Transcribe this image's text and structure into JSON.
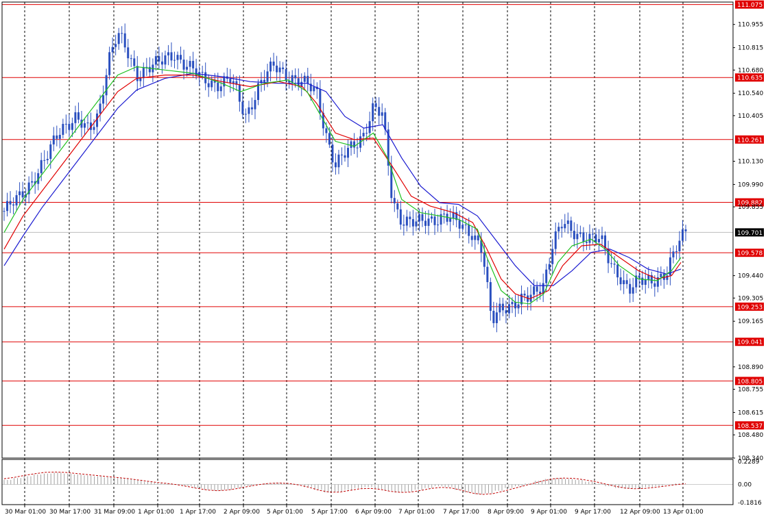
{
  "chart_data": {
    "type": "candlestick",
    "price_axis": {
      "min": 108.34,
      "max": 111.09,
      "tick_labels": [
        "110.955",
        "110.815",
        "110.680",
        "110.540",
        "110.405",
        "110.130",
        "109.990",
        "109.855",
        "109.440",
        "109.305",
        "109.165",
        "108.890",
        "108.755",
        "108.615",
        "108.480",
        "108.340"
      ]
    },
    "current_price": {
      "value": 109.701,
      "label": "109.701",
      "color": "#000000"
    },
    "levels": [
      {
        "value": 111.075,
        "label": "111.075"
      },
      {
        "value": 110.635,
        "label": "110.635"
      },
      {
        "value": 110.261,
        "label": "110.261"
      },
      {
        "value": 109.882,
        "label": "109.882"
      },
      {
        "value": 109.578,
        "label": "109.578"
      },
      {
        "value": 109.253,
        "label": "109.253"
      },
      {
        "value": 109.041,
        "label": "109.041"
      },
      {
        "value": 108.805,
        "label": "108.805"
      },
      {
        "value": 108.537,
        "label": "108.537"
      }
    ],
    "time_labels": [
      "30 Mar 01:00",
      "30 Mar 17:00",
      "31 Mar 09:00",
      "1 Apr 01:00",
      "1 Apr 17:00",
      "2 Apr 09:00",
      "5 Apr 01:00",
      "5 Apr 17:00",
      "6 Apr 09:00",
      "7 Apr 01:00",
      "7 Apr 17:00",
      "8 Apr 09:00",
      "9 Apr 01:00",
      "9 Apr 17:00",
      "12 Apr 09:00",
      "13 Apr 01:00"
    ],
    "close_path": [
      [
        0,
        109.83
      ],
      [
        3,
        109.9
      ],
      [
        6,
        110.02
      ],
      [
        9,
        110.15
      ],
      [
        12,
        110.33
      ],
      [
        15,
        110.4
      ],
      [
        18,
        110.3
      ],
      [
        20,
        110.42
      ],
      [
        22,
        110.75
      ],
      [
        24,
        110.9
      ],
      [
        26,
        110.78
      ],
      [
        28,
        110.65
      ],
      [
        30,
        110.7
      ],
      [
        33,
        110.72
      ],
      [
        36,
        110.78
      ],
      [
        39,
        110.7
      ],
      [
        42,
        110.62
      ],
      [
        45,
        110.6
      ],
      [
        48,
        110.62
      ],
      [
        51,
        110.4
      ],
      [
        54,
        110.6
      ],
      [
        57,
        110.7
      ],
      [
        60,
        110.65
      ],
      [
        63,
        110.6
      ],
      [
        66,
        110.55
      ],
      [
        68,
        110.3
      ],
      [
        70,
        110.1
      ],
      [
        73,
        110.2
      ],
      [
        76,
        110.3
      ],
      [
        78,
        110.45
      ],
      [
        80,
        110.4
      ],
      [
        82,
        109.9
      ],
      [
        84,
        109.78
      ],
      [
        87,
        109.75
      ],
      [
        90,
        109.78
      ],
      [
        93,
        109.8
      ],
      [
        96,
        109.75
      ],
      [
        99,
        109.7
      ],
      [
        101,
        109.6
      ],
      [
        103,
        109.15
      ],
      [
        105,
        109.25
      ],
      [
        108,
        109.28
      ],
      [
        111,
        109.3
      ],
      [
        114,
        109.4
      ],
      [
        116,
        109.65
      ],
      [
        118,
        109.75
      ],
      [
        120,
        109.7
      ],
      [
        123,
        109.68
      ],
      [
        126,
        109.65
      ],
      [
        128,
        109.52
      ],
      [
        130,
        109.45
      ],
      [
        132,
        109.35
      ],
      [
        134,
        109.4
      ],
      [
        137,
        109.42
      ],
      [
        140,
        109.45
      ],
      [
        142,
        109.6
      ],
      [
        144,
        109.72
      ]
    ],
    "ma_fast": [
      [
        0,
        109.7
      ],
      [
        4,
        109.9
      ],
      [
        8,
        110.05
      ],
      [
        12,
        110.2
      ],
      [
        16,
        110.35
      ],
      [
        20,
        110.5
      ],
      [
        24,
        110.65
      ],
      [
        28,
        110.7
      ],
      [
        34,
        110.68
      ],
      [
        40,
        110.66
      ],
      [
        46,
        110.6
      ],
      [
        50,
        110.55
      ],
      [
        55,
        110.6
      ],
      [
        60,
        110.62
      ],
      [
        64,
        110.55
      ],
      [
        67,
        110.4
      ],
      [
        70,
        110.25
      ],
      [
        74,
        110.22
      ],
      [
        78,
        110.3
      ],
      [
        81,
        110.15
      ],
      [
        84,
        109.9
      ],
      [
        88,
        109.82
      ],
      [
        92,
        109.8
      ],
      [
        96,
        109.78
      ],
      [
        100,
        109.72
      ],
      [
        102,
        109.55
      ],
      [
        105,
        109.35
      ],
      [
        108,
        109.28
      ],
      [
        111,
        109.27
      ],
      [
        114,
        109.33
      ],
      [
        117,
        109.52
      ],
      [
        120,
        109.62
      ],
      [
        124,
        109.66
      ],
      [
        127,
        109.6
      ],
      [
        130,
        109.5
      ],
      [
        134,
        109.42
      ],
      [
        138,
        109.41
      ],
      [
        141,
        109.47
      ],
      [
        143,
        109.55
      ]
    ],
    "ma_mid": [
      [
        0,
        109.6
      ],
      [
        4,
        109.8
      ],
      [
        8,
        109.95
      ],
      [
        12,
        110.1
      ],
      [
        16,
        110.25
      ],
      [
        20,
        110.4
      ],
      [
        24,
        110.55
      ],
      [
        28,
        110.63
      ],
      [
        34,
        110.65
      ],
      [
        40,
        110.65
      ],
      [
        46,
        110.61
      ],
      [
        52,
        110.58
      ],
      [
        58,
        110.61
      ],
      [
        63,
        110.58
      ],
      [
        66,
        110.48
      ],
      [
        70,
        110.3
      ],
      [
        74,
        110.26
      ],
      [
        78,
        110.27
      ],
      [
        82,
        110.1
      ],
      [
        86,
        109.92
      ],
      [
        90,
        109.86
      ],
      [
        95,
        109.82
      ],
      [
        99,
        109.76
      ],
      [
        102,
        109.6
      ],
      [
        105,
        109.42
      ],
      [
        108,
        109.33
      ],
      [
        111,
        109.3
      ],
      [
        115,
        109.35
      ],
      [
        118,
        109.5
      ],
      [
        122,
        109.62
      ],
      [
        126,
        109.63
      ],
      [
        130,
        109.55
      ],
      [
        134,
        109.47
      ],
      [
        138,
        109.42
      ],
      [
        141,
        109.44
      ],
      [
        143,
        109.52
      ]
    ],
    "ma_slow": [
      [
        0,
        109.5
      ],
      [
        4,
        109.68
      ],
      [
        8,
        109.85
      ],
      [
        12,
        110.0
      ],
      [
        16,
        110.15
      ],
      [
        20,
        110.3
      ],
      [
        24,
        110.45
      ],
      [
        28,
        110.56
      ],
      [
        34,
        110.63
      ],
      [
        40,
        110.66
      ],
      [
        46,
        110.64
      ],
      [
        52,
        110.61
      ],
      [
        58,
        110.6
      ],
      [
        64,
        110.6
      ],
      [
        68,
        110.55
      ],
      [
        72,
        110.4
      ],
      [
        76,
        110.33
      ],
      [
        80,
        110.35
      ],
      [
        84,
        110.15
      ],
      [
        88,
        109.98
      ],
      [
        92,
        109.88
      ],
      [
        96,
        109.87
      ],
      [
        100,
        109.8
      ],
      [
        104,
        109.65
      ],
      [
        108,
        109.5
      ],
      [
        112,
        109.38
      ],
      [
        116,
        109.38
      ],
      [
        120,
        109.47
      ],
      [
        124,
        109.58
      ],
      [
        128,
        109.6
      ],
      [
        132,
        109.55
      ],
      [
        136,
        109.48
      ],
      [
        140,
        109.45
      ],
      [
        143,
        109.48
      ]
    ],
    "oscillator": {
      "scale_labels": [
        "0.2289",
        "0.00",
        "-0.1816"
      ],
      "min": -0.1816,
      "max": 0.2289,
      "values": [
        0.05,
        0.07,
        0.09,
        0.11,
        0.12,
        0.13,
        0.12,
        0.11,
        0.1,
        0.09,
        0.08,
        0.07,
        0.06,
        0.05,
        0.03,
        0.02,
        0.01,
        0.0,
        -0.02,
        -0.04,
        -0.06,
        -0.07,
        -0.06,
        -0.04,
        -0.02,
        0.0,
        0.01,
        0.02,
        0.01,
        0.0,
        -0.03,
        -0.06,
        -0.09,
        -0.08,
        -0.06,
        -0.04,
        -0.03,
        -0.05,
        -0.07,
        -0.09,
        -0.08,
        -0.06,
        -0.04,
        -0.02,
        -0.03,
        -0.06,
        -0.09,
        -0.11,
        -0.1,
        -0.07,
        -0.04,
        -0.02,
        0.01,
        0.04,
        0.06,
        0.07,
        0.06,
        0.05,
        0.03,
        0.01,
        -0.02,
        -0.04,
        -0.05,
        -0.04,
        -0.03,
        -0.02,
        0.0,
        0.01
      ]
    }
  }
}
